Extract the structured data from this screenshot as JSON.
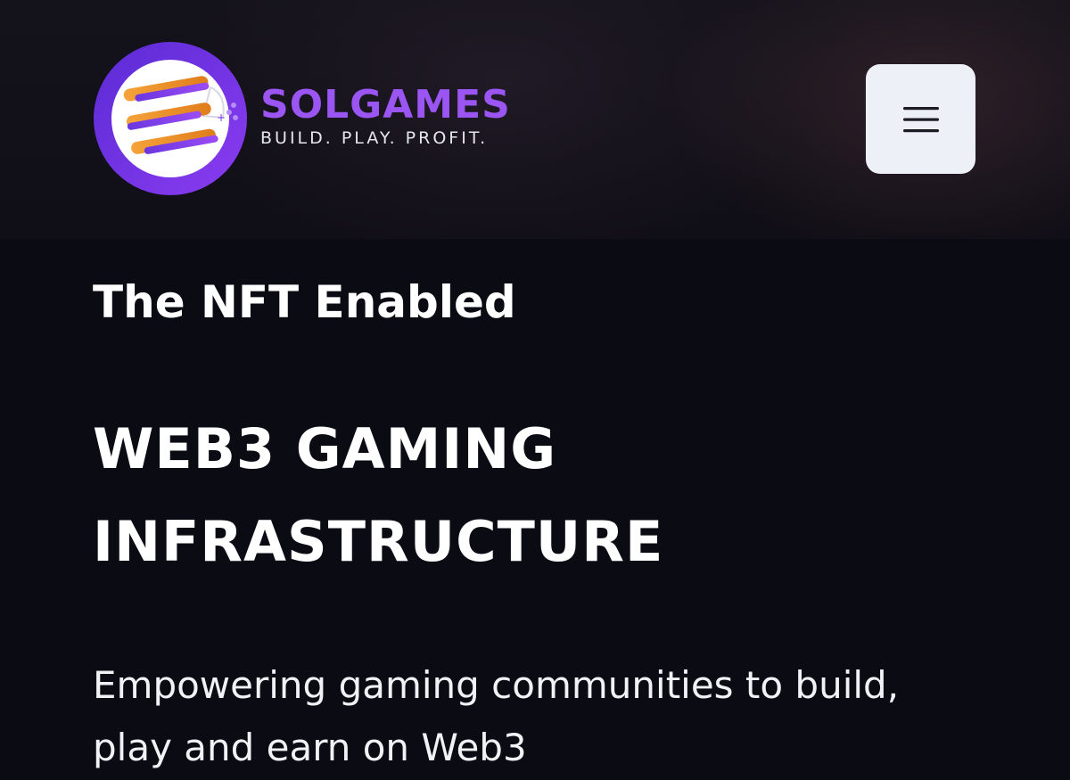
{
  "header": {
    "logo": {
      "icon": "controller-s-emblem-icon",
      "brand_name": "SOLGAMES",
      "tagline": "BUILD. PLAY. PROFIT."
    },
    "menu_button": {
      "icon": "hamburger-menu-icon"
    }
  },
  "hero": {
    "kicker": "The NFT Enabled",
    "title_lines": [
      "WEB3 GAMING",
      "INFRASTRUCTURE"
    ],
    "subtitle_lines": [
      "Empowering gaming communities to build,",
      "play and earn on Web3"
    ]
  },
  "colors": {
    "background": "#0b0b14",
    "brand_purple": "#9a55f2",
    "emblem_orange": "#f29a2e",
    "emblem_violet": "#7c3aed",
    "menu_button_bg": "#eef0f8"
  }
}
